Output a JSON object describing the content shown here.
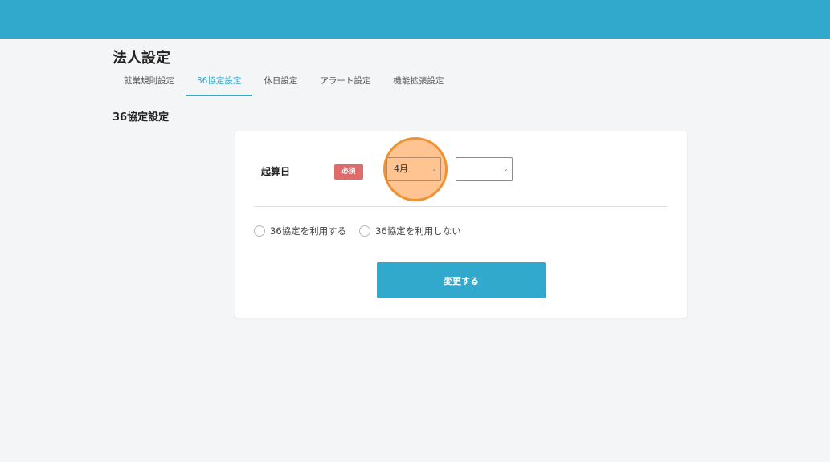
{
  "page": {
    "title": "法人設定",
    "section_title": "36協定設定"
  },
  "tabs": [
    {
      "label": "就業規則設定",
      "active": false
    },
    {
      "label": "36協定設定",
      "active": true
    },
    {
      "label": "休日設定",
      "active": false
    },
    {
      "label": "アラート設定",
      "active": false
    },
    {
      "label": "機能拡張設定",
      "active": false
    }
  ],
  "form": {
    "start_date_label": "起算日",
    "required_badge": "必須",
    "month_select_value": "4月",
    "day_select_value": "",
    "radio_options": [
      {
        "label": "36協定を利用する",
        "checked": false
      },
      {
        "label": "36協定を利用しない",
        "checked": false
      }
    ],
    "submit_label": "変更する"
  },
  "colors": {
    "accent": "#31a9cc",
    "required": "#e06b6b",
    "highlight": "#f09232"
  }
}
